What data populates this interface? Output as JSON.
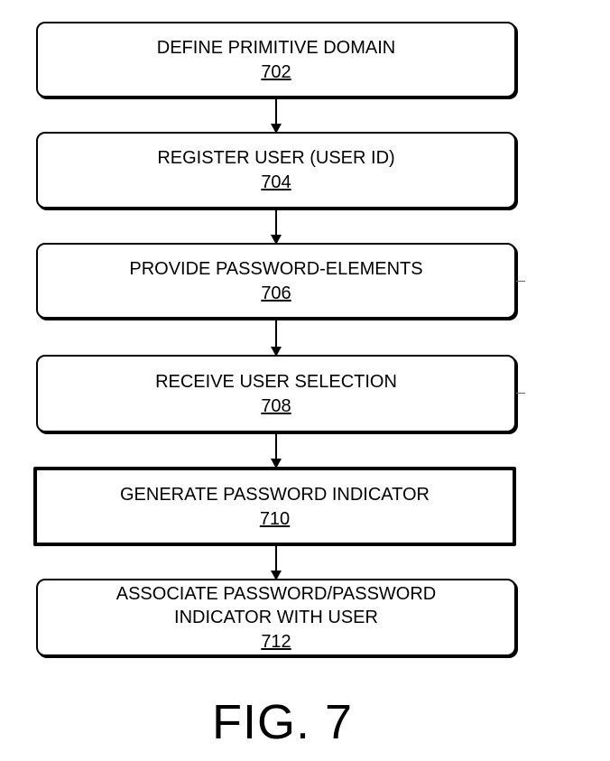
{
  "figure": {
    "label": "FIG. 7"
  },
  "steps": [
    {
      "text": "DEFINE PRIMITIVE DOMAIN",
      "ref": "702"
    },
    {
      "text": "REGISTER USER (USER ID)",
      "ref": "704"
    },
    {
      "text": "PROVIDE PASSWORD-ELEMENTS",
      "ref": "706"
    },
    {
      "text": "RECEIVE USER SELECTION",
      "ref": "708"
    },
    {
      "text": "GENERATE PASSWORD INDICATOR",
      "ref": "710"
    },
    {
      "text": "ASSOCIATE PASSWORD/PASSWORD INDICATOR WITH USER",
      "ref": "712"
    }
  ]
}
